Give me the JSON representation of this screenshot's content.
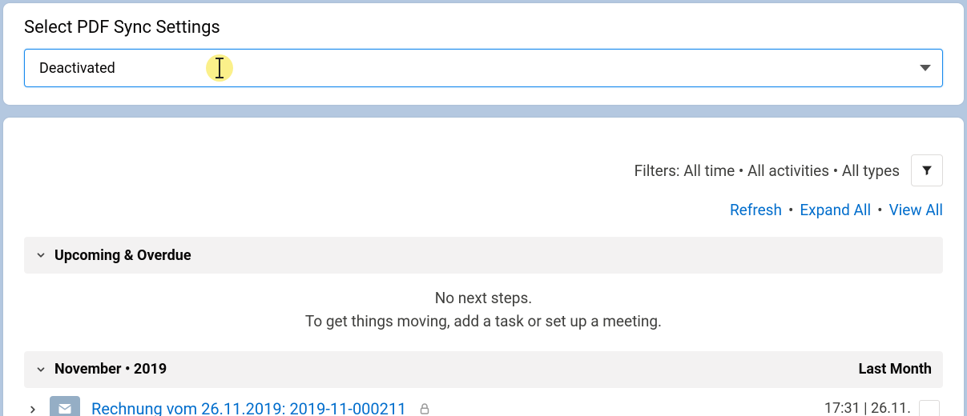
{
  "settings": {
    "title": "Select PDF Sync Settings",
    "selected_value": "Deactivated"
  },
  "filters": {
    "prefix": "Filters:",
    "time": "All time",
    "activities": "All activities",
    "types": "All types"
  },
  "links": {
    "refresh": "Refresh",
    "expand_all": "Expand All",
    "view_all": "View All"
  },
  "sections": {
    "upcoming": {
      "title": "Upcoming & Overdue",
      "empty_line1": "No next steps.",
      "empty_line2": "To get things moving, add a task or set up a meeting."
    },
    "month": {
      "title": "November • 2019",
      "relative": "Last Month"
    }
  },
  "entry": {
    "subject": "Rechnung vom 26.11.2019: 2019-11-000211",
    "time": "17:31 | 26.11."
  }
}
